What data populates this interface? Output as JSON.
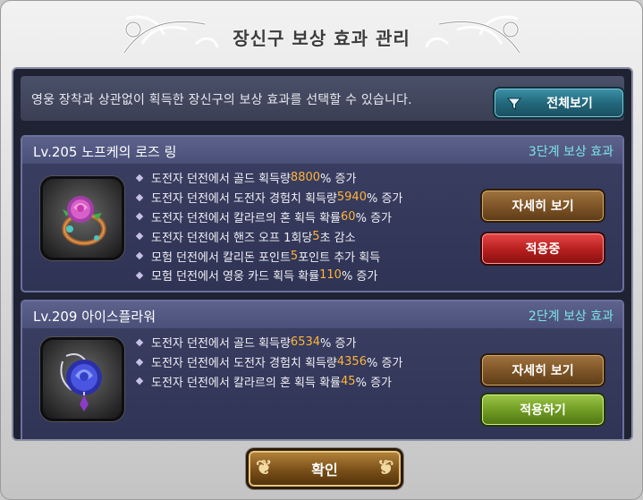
{
  "dialog": {
    "title": "장신구 보상 효과 관리"
  },
  "info": {
    "description": "영웅 장착과 상관없이 획득한 장신구의 보상 효과를 선택할 수 있습니다."
  },
  "filter_button": {
    "label": "전체보기",
    "icon": "filter-funnel-icon"
  },
  "accessories": [
    {
      "name": "Lv.205 노프케의 로즈 링",
      "tier": "3단계 보상 효과",
      "icon": "rose-ring-icon",
      "effects": [
        {
          "pre": "도전자 던전에서 골드 획득량 ",
          "value": "8800",
          "post": "% 증가"
        },
        {
          "pre": "도전자 던전에서 도전자 경험치 획득량 ",
          "value": "5940",
          "post": "% 증가"
        },
        {
          "pre": "도전자 던전에서 칼라르의 혼 획득 확률 ",
          "value": "60",
          "post": "% 증가"
        },
        {
          "pre": "도전자 던전에서 핸즈 오프 1회당 ",
          "value": "5",
          "post": "초 감소"
        },
        {
          "pre": "모험 던전에서 칼리돈 포인트 ",
          "value": "5",
          "post": "포인트 추가 획득"
        },
        {
          "pre": "모험 던전에서 영웅 카드 획득 확률 ",
          "value": "110",
          "post": "% 증가"
        }
      ],
      "detail_label": "자세히 보기",
      "apply_label": "적용중"
    },
    {
      "name": "Lv.209 아이스플라워",
      "tier": "2단계 보상 효과",
      "icon": "ice-flower-icon",
      "effects": [
        {
          "pre": "도전자 던전에서 골드 획득량 ",
          "value": "6534",
          "post": "% 증가"
        },
        {
          "pre": "도전자 던전에서 도전자 경험치 획득량 ",
          "value": "4356",
          "post": "% 증가"
        },
        {
          "pre": "도전자 던전에서 칼라르의 혼 획득 확률 ",
          "value": "45",
          "post": "% 증가"
        }
      ],
      "detail_label": "자세히 보기",
      "apply_label": "적용하기"
    }
  ],
  "confirm_button": {
    "label": "확인"
  },
  "colors": {
    "highlight": "#ffb43a",
    "tier_text": "#7de3e8",
    "applied_button": "#b51e1e",
    "apply_button": "#6e9a22",
    "detail_button": "#7c5326"
  }
}
